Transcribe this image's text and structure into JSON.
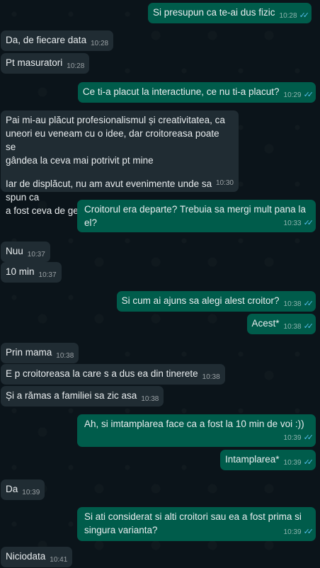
{
  "messages": [
    {
      "side": "out",
      "text": "Si presupun ca te-ai dus fizic",
      "time": "10:28",
      "read": true
    },
    {
      "side": "in",
      "text": "Da, de fiecare data",
      "time": "10:28"
    },
    {
      "side": "in",
      "text": "Pt masuratori",
      "time": "10:28"
    },
    {
      "side": "out",
      "text": "Ce ti-a placut la interactiune, ce nu ti-a placut?",
      "time": "10:29",
      "read": true
    },
    {
      "side": "in",
      "lines": [
        "Pai mi-au plăcut profesionalismul și creativitatea, ca",
        "uneori eu veneam cu o idee, dar croitoreasa poate se",
        "gândea la ceva mai potrivit pt mine",
        "",
        "Iar de displăcut, nu am avut evenimente unde sa spun ca",
        "a fost ceva de genul"
      ],
      "time": "10:30"
    },
    {
      "side": "out",
      "text": "Croitorul era departe? Trebuia sa mergi mult pana la el?",
      "time": "10:33",
      "read": true
    },
    {
      "side": "in",
      "text": "Nuu",
      "time": "10:37"
    },
    {
      "side": "in",
      "text": "10 min",
      "time": "10:37"
    },
    {
      "side": "out",
      "text": "Si cum ai ajuns sa alegi alest croitor?",
      "time": "10:38",
      "read": true
    },
    {
      "side": "out",
      "text": "Acest*",
      "time": "10:38",
      "read": true
    },
    {
      "side": "in",
      "text": "Prin mama",
      "time": "10:38"
    },
    {
      "side": "in",
      "text": "E p croitoreasa la care s a dus ea din tinerete",
      "time": "10:38"
    },
    {
      "side": "in",
      "text": "Și a rămas a familiei sa zic asa",
      "time": "10:38"
    },
    {
      "side": "out",
      "text": "Ah, si imtamplarea face ca a fost la 10 min de voi :))",
      "time": "10:39",
      "read": true
    },
    {
      "side": "out",
      "text": "Intamplarea*",
      "time": "10:39",
      "read": true
    },
    {
      "side": "in",
      "text": "Da",
      "time": "10:39"
    },
    {
      "side": "out",
      "lines": [
        "Si ati considerat si alti croitori sau ea a fost prima si",
        "singura varianta?"
      ],
      "time": "10:39",
      "read": true
    },
    {
      "side": "in",
      "text": "Niciodata",
      "time": "10:41"
    }
  ],
  "colors": {
    "background": "#0b141a",
    "incoming": "#202c33",
    "outgoing": "#005c4b",
    "read_ticks": "#53bdeb"
  },
  "icons": {
    "read_ticks": "double-check-icon"
  }
}
